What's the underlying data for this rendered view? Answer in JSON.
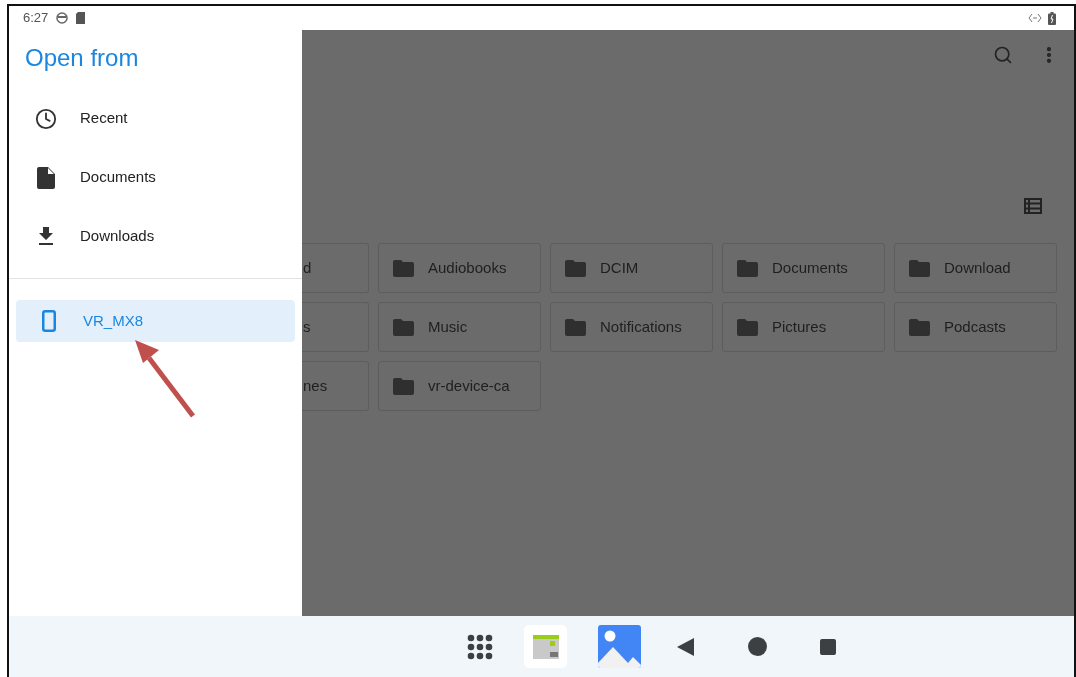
{
  "status_bar": {
    "time": "6:27"
  },
  "drawer": {
    "title": "Open from",
    "items": [
      {
        "label": "Recent",
        "kind": "clock",
        "selected": false
      },
      {
        "label": "Documents",
        "kind": "file",
        "selected": false
      },
      {
        "label": "Downloads",
        "kind": "download",
        "selected": false
      }
    ],
    "devices": [
      {
        "label": "VR_MX8",
        "kind": "phone",
        "selected": true
      }
    ]
  },
  "folders": [
    {
      "name": "d"
    },
    {
      "name": "Audiobooks"
    },
    {
      "name": "DCIM"
    },
    {
      "name": "Documents"
    },
    {
      "name": "Download"
    },
    {
      "name": "s"
    },
    {
      "name": "Music"
    },
    {
      "name": "Notifications"
    },
    {
      "name": "Pictures"
    },
    {
      "name": "Podcasts"
    },
    {
      "name": "nes"
    },
    {
      "name": "vr-device-ca"
    }
  ]
}
